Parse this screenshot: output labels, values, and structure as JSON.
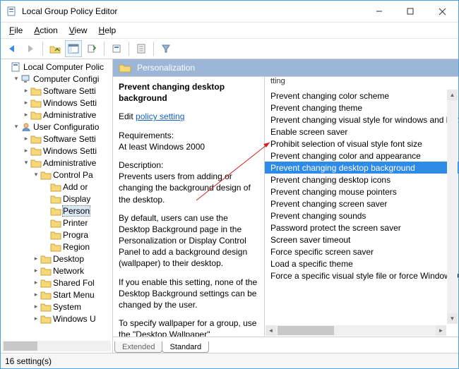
{
  "window": {
    "title": "Local Group Policy Editor"
  },
  "menu": [
    {
      "accel": "F",
      "rest": "ile"
    },
    {
      "accel": "A",
      "rest": "ction"
    },
    {
      "accel": "V",
      "rest": "iew"
    },
    {
      "accel": "H",
      "rest": "elp"
    }
  ],
  "tree": [
    {
      "d": 0,
      "tw": "",
      "icon": "policy",
      "label": "Local Computer Polic"
    },
    {
      "d": 1,
      "tw": "v",
      "icon": "comp",
      "label": "Computer Configi"
    },
    {
      "d": 2,
      "tw": ">",
      "icon": "fold",
      "label": "Software Setti"
    },
    {
      "d": 2,
      "tw": ">",
      "icon": "fold",
      "label": "Windows Setti"
    },
    {
      "d": 2,
      "tw": ">",
      "icon": "fold",
      "label": "Administrative"
    },
    {
      "d": 1,
      "tw": "v",
      "icon": "user",
      "label": "User Configuratio"
    },
    {
      "d": 2,
      "tw": ">",
      "icon": "fold",
      "label": "Software Setti"
    },
    {
      "d": 2,
      "tw": ">",
      "icon": "fold",
      "label": "Windows Setti"
    },
    {
      "d": 2,
      "tw": "v",
      "icon": "fold",
      "label": "Administrative"
    },
    {
      "d": 3,
      "tw": "v",
      "icon": "fold",
      "label": "Control Pa"
    },
    {
      "d": 4,
      "tw": "",
      "icon": "fold",
      "label": "Add or"
    },
    {
      "d": 4,
      "tw": "",
      "icon": "fold",
      "label": "Display"
    },
    {
      "d": 4,
      "tw": "",
      "icon": "fold",
      "label": "Person",
      "sel": true
    },
    {
      "d": 4,
      "tw": "",
      "icon": "fold",
      "label": "Printer"
    },
    {
      "d": 4,
      "tw": "",
      "icon": "fold",
      "label": "Progra"
    },
    {
      "d": 4,
      "tw": "",
      "icon": "fold",
      "label": "Region"
    },
    {
      "d": 3,
      "tw": ">",
      "icon": "fold",
      "label": "Desktop"
    },
    {
      "d": 3,
      "tw": ">",
      "icon": "fold",
      "label": "Network"
    },
    {
      "d": 3,
      "tw": ">",
      "icon": "fold",
      "label": "Shared Fol"
    },
    {
      "d": 3,
      "tw": ">",
      "icon": "fold",
      "label": "Start Menu"
    },
    {
      "d": 3,
      "tw": ">",
      "icon": "fold",
      "label": "System"
    },
    {
      "d": 3,
      "tw": ">",
      "icon": "fold",
      "label": "Windows U"
    }
  ],
  "pane": {
    "header": "Personalization"
  },
  "desc": {
    "title": "Prevent changing desktop background",
    "edit_prefix": "Edit",
    "edit_link": "policy setting",
    "req_label": "Requirements:",
    "req_text": "At least Windows 2000",
    "desc_label": "Description:",
    "p1": "Prevents users from adding or changing the background design of the desktop.",
    "p2": "By default, users can use the Desktop Background page in the Personalization or Display Control Panel to add a background design (wallpaper) to their desktop.",
    "p3": "If you enable this setting, none of the Desktop Background settings can be changed by the user.",
    "p4": "To specify wallpaper for a group, use the \"Desktop Wallpaper\""
  },
  "list": {
    "col_fragment": "tting",
    "items": [
      {
        "label": "Prevent changing color scheme"
      },
      {
        "label": "Prevent changing theme"
      },
      {
        "label": "Prevent changing visual style for windows and butto"
      },
      {
        "label": "Enable screen saver"
      },
      {
        "label": "Prohibit selection of visual style font size"
      },
      {
        "label": "Prevent changing color and appearance"
      },
      {
        "label": "Prevent changing desktop background",
        "sel": true
      },
      {
        "label": "Prevent changing desktop icons"
      },
      {
        "label": "Prevent changing mouse pointers"
      },
      {
        "label": "Prevent changing screen saver"
      },
      {
        "label": "Prevent changing sounds"
      },
      {
        "label": "Password protect the screen saver"
      },
      {
        "label": "Screen saver timeout"
      },
      {
        "label": "Force specific screen saver"
      },
      {
        "label": "Load a specific theme"
      },
      {
        "label": "Force a specific visual style file or force Windows Clas"
      }
    ]
  },
  "tabs": [
    "Extended",
    "Standard"
  ],
  "status": "16 setting(s)",
  "colors": {
    "accent": "#2e8be6",
    "header": "#9BB6D6"
  }
}
